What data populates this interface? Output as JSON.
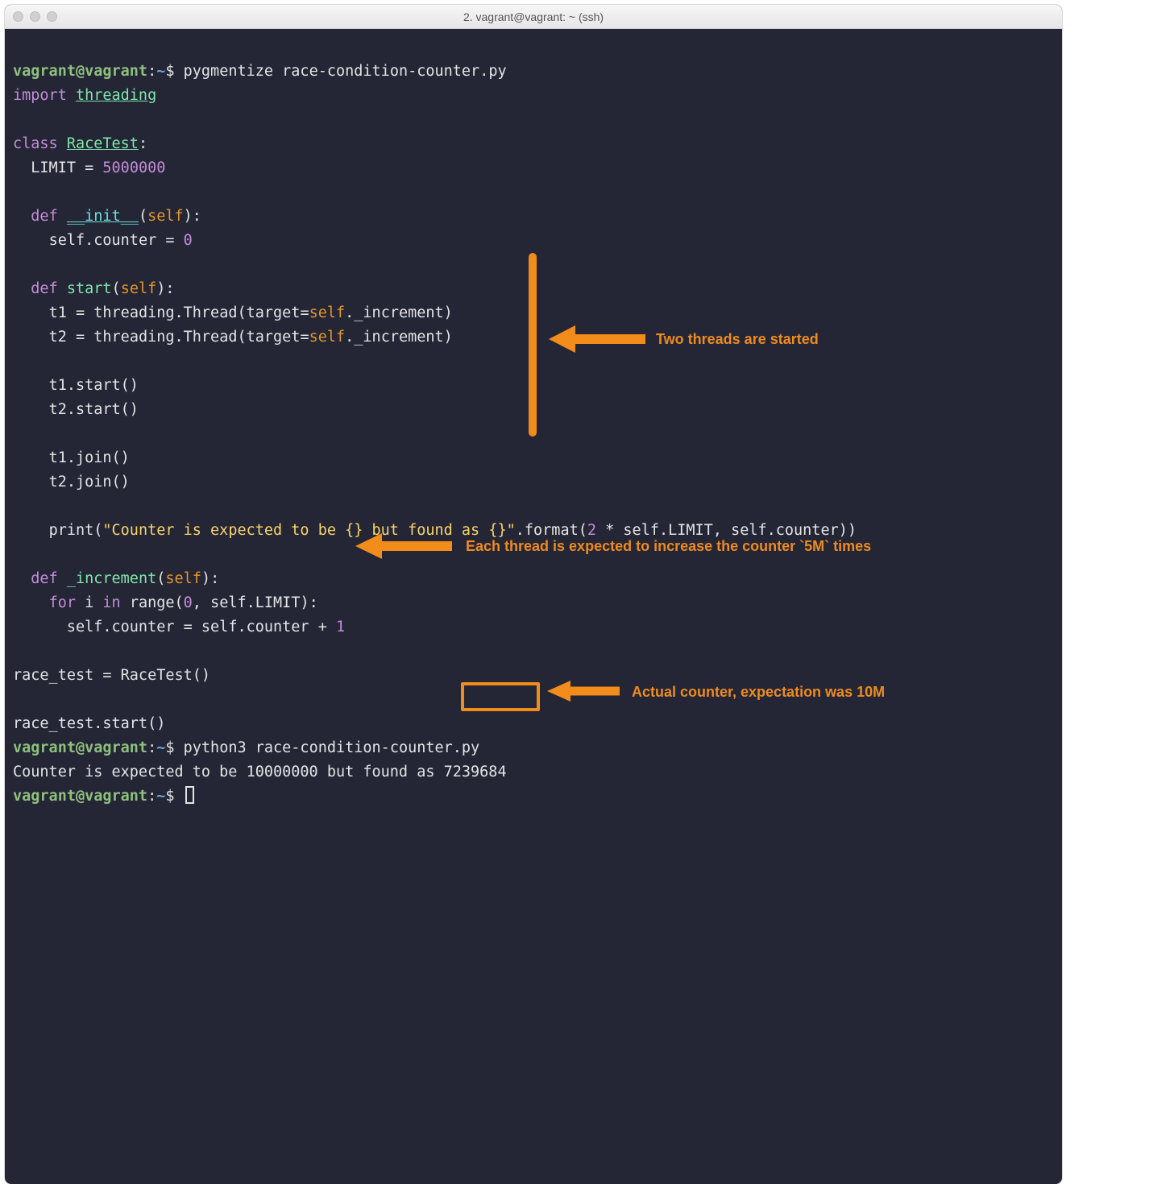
{
  "window": {
    "title": "2. vagrant@vagrant: ~ (ssh)"
  },
  "prompt": {
    "user_host": "vagrant@vagrant",
    "sep": ":",
    "path": "~",
    "dollar": "$"
  },
  "commands": {
    "cmd1": "pygmentize race-condition-counter.py",
    "cmd2": "python3 race-condition-counter.py"
  },
  "code": {
    "import_kw": "import",
    "import_mod": "threading",
    "class_kw": "class",
    "class_name": "RaceTest",
    "limit_name": "LIMIT",
    "limit_val": "5000000",
    "def_kw": "def",
    "init_name": "__init__",
    "self": "self",
    "counter_zero": "self.counter = 0",
    "start_name": "start",
    "t1_assign": "t1 = threading.Thread(target=self._increment)",
    "t2_assign": "t2 = threading.Thread(target=self._increment)",
    "t1_start": "t1.start()",
    "t2_start": "t2.start()",
    "t1_join": "t1.join()",
    "t2_join": "t2.join()",
    "print_prefix": "print(",
    "print_str": "\"Counter is expected to be {} but found as {}\"",
    "print_suffix_a": ".format(",
    "print_two": "2",
    "print_suffix_b": " * self.LIMIT, self.counter))",
    "inc_name": "_increment",
    "for_kw": "for",
    "in_kw": "in",
    "range_call_a": "range(",
    "range_zero": "0",
    "range_call_b": ", self.LIMIT):",
    "i_var": "i",
    "inc_body": "self.counter = self.counter + ",
    "one": "1",
    "rt_assign": "race_test = RaceTest()",
    "rt_start": "race_test.start()"
  },
  "output": {
    "line": "Counter is expected to be 10000000 but found as 7239684",
    "highlight_value": "7239684"
  },
  "annotations": {
    "a1": "Two threads are started",
    "a2": "Each thread is expected to increase the counter `5M` times",
    "a3": "Actual counter, expectation was 10M"
  }
}
